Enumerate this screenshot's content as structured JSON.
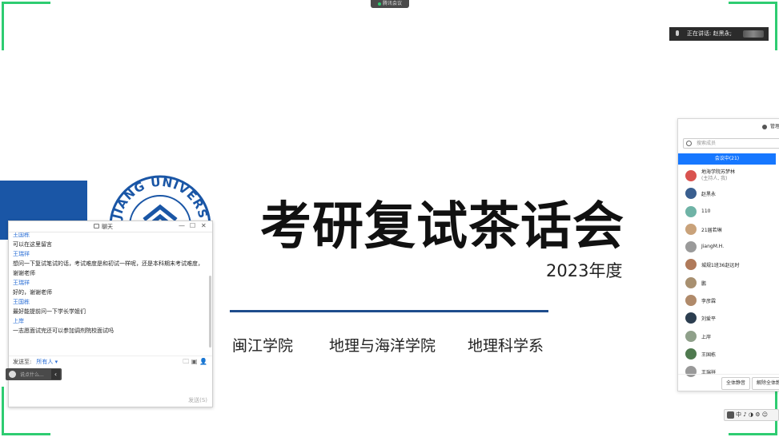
{
  "top_chip": {
    "label": "腾讯会议"
  },
  "speaking": {
    "label": "正在讲话: 赵黑永;"
  },
  "slide": {
    "logo_text": "JIANG UNIVERS",
    "title": "考研复试茶话会",
    "year": "2023年度",
    "departments": [
      "闽江学院",
      "地理与海洋学院",
      "地理科学系"
    ]
  },
  "chat": {
    "title": "聊天",
    "win_minimize": "—",
    "win_maximize": "☐",
    "win_close": "✕",
    "messages": [
      {
        "name": "王国栋",
        "text": "可以在这里留言"
      },
      {
        "name": "王瑞祥",
        "text": "想问一下复试笔试的话，考试难度是和初试一样呢，还是本科期末考试难度，谢谢老师"
      },
      {
        "name": "王瑞祥",
        "text": "好的，谢谢老师"
      },
      {
        "name": "王国栋",
        "text": "最好能提前问一下学长学姐们"
      },
      {
        "name": "上岸",
        "text": "一志愿面试完还可以参加调剂院校面试吗"
      }
    ],
    "send_to_label": "发送至:",
    "send_to_value": "所有人 ▾",
    "input_placeholder": "说点什么...",
    "send_button": "发送(S)"
  },
  "members": {
    "manage_label": "管理",
    "search_placeholder": "搜索成员",
    "tab_label": "会议中(21)",
    "list": [
      {
        "name": "地海学院苏梦林",
        "sub": "(主持人, 我)",
        "color": "#d9534f"
      },
      {
        "name": "赵黑永",
        "sub": "",
        "color": "#3a5f8f"
      },
      {
        "name": "110",
        "sub": "",
        "color": "#6fb3a6"
      },
      {
        "name": "21届若琳",
        "sub": "",
        "color": "#c9a27a"
      },
      {
        "name": "JiangM.H.",
        "sub": "",
        "color": "#9a9a9a"
      },
      {
        "name": "城规1班36赵远时",
        "sub": "",
        "color": "#b07a5a"
      },
      {
        "name": "鹏",
        "sub": "",
        "color": "#a89070"
      },
      {
        "name": "李彦霖",
        "sub": "",
        "color": "#b08a6a"
      },
      {
        "name": "刘爱平",
        "sub": "",
        "color": "#2c3e50"
      },
      {
        "name": "上岸",
        "sub": "",
        "color": "#8fa08a"
      },
      {
        "name": "王国栋",
        "sub": "",
        "color": "#4f7a4f"
      },
      {
        "name": "王瑞祥",
        "sub": "",
        "color": "#999999"
      }
    ],
    "mute_all": "全体静音",
    "unmute_all": "解除全体静音"
  },
  "ime": {
    "label": "中 ♪ ◑ ⚙ ☺"
  }
}
